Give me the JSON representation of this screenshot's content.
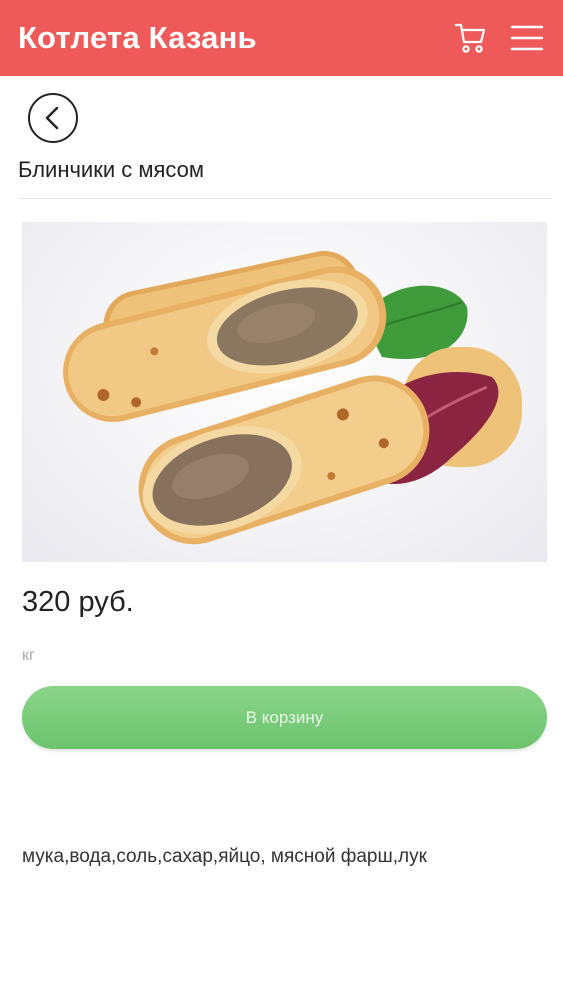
{
  "header": {
    "brand": "Котлета Казань",
    "background": "#ee5a5a",
    "cart_icon": "cart-icon",
    "menu_icon": "hamburger-menu-icon"
  },
  "product": {
    "title": "Блинчики с мясом",
    "price": "320 руб.",
    "unit": "кг",
    "add_to_cart_label": "В корзину",
    "ingredients": "мука,вода,соль,сахар,яйцо, мясной фарш,лук",
    "image_subject": "stuffed crepes with meat"
  },
  "colors": {
    "accent_green": "#6cc46c",
    "header_red": "#ee5a5a"
  }
}
